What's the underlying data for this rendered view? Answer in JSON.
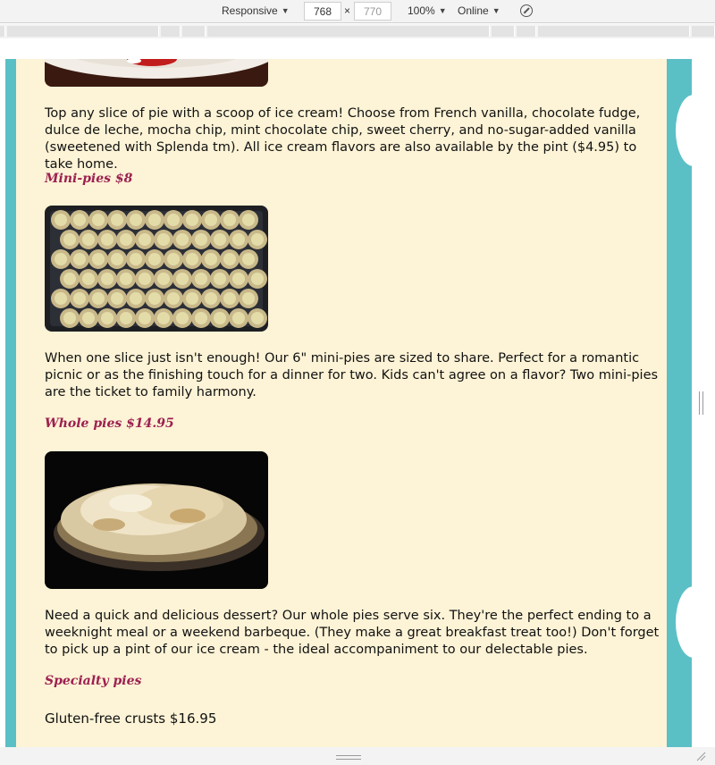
{
  "toolbar": {
    "device": "Responsive",
    "width": "768",
    "height": "770",
    "zoom": "100%",
    "network": "Online",
    "dim_separator": "×",
    "caret": "▼"
  },
  "page": {
    "icecream_text": "Top any slice of pie with a scoop of ice cream! Choose from French vanilla, chocolate fudge, dulce de leche, mocha chip, mint chocolate chip, sweet cherry, and no-sugar-added vanilla (sweetened with Splenda tm). All ice cream flavors are also available by the pint ($4.95) to take home.",
    "minipies_heading": "Mini-pies $8",
    "minipies_text": "When one slice just isn't enough! Our 6\" mini-pies are sized to share. Perfect for a romantic picnic or as the finishing touch for a dinner for two. Kids can't agree on a flavor? Two mini-pies are the ticket to family harmony.",
    "wholepies_heading": "Whole pies $14.95",
    "wholepies_text": "Need a quick and delicious dessert? Our whole pies serve six. They're the perfect ending to a weeknight meal or a weekend barbeque. (They make a great breakfast treat too!) Don't forget to pick up a pint of our ice cream - the ideal accompaniment to our delectable pies.",
    "specialty_heading": "Specialty pies",
    "gluten_free": "Gluten-free crusts $16.95"
  },
  "colors": {
    "accent_heading": "#9c2050",
    "page_bg": "#fdf3d6",
    "border_teal": "#5bbfc6"
  }
}
